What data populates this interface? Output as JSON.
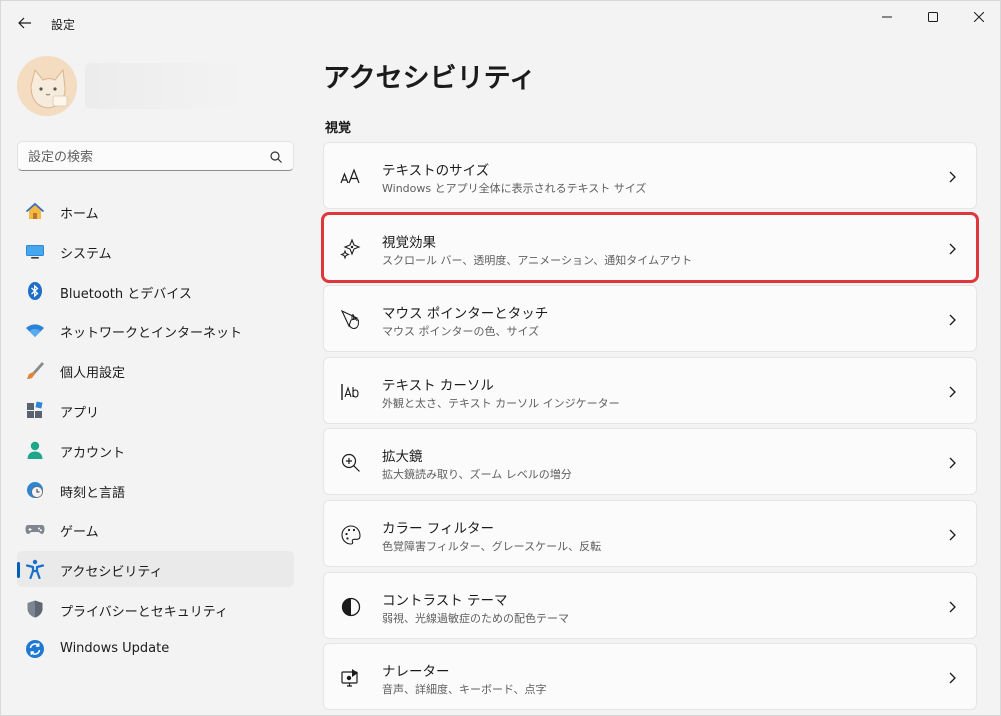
{
  "window": {
    "title": "設定"
  },
  "search": {
    "placeholder": "設定の検索"
  },
  "sidebar": {
    "items": [
      {
        "label": "ホーム",
        "icon": "home-icon"
      },
      {
        "label": "システム",
        "icon": "system-icon"
      },
      {
        "label": "Bluetooth とデバイス",
        "icon": "bluetooth-icon"
      },
      {
        "label": "ネットワークとインターネット",
        "icon": "wifi-icon"
      },
      {
        "label": "個人用設定",
        "icon": "brush-icon"
      },
      {
        "label": "アプリ",
        "icon": "apps-icon"
      },
      {
        "label": "アカウント",
        "icon": "account-icon"
      },
      {
        "label": "時刻と言語",
        "icon": "clock-globe-icon"
      },
      {
        "label": "ゲーム",
        "icon": "gamepad-icon"
      },
      {
        "label": "アクセシビリティ",
        "icon": "accessibility-icon"
      },
      {
        "label": "プライバシーとセキュリティ",
        "icon": "shield-icon"
      },
      {
        "label": "Windows Update",
        "icon": "update-icon"
      }
    ],
    "selected": "アクセシビリティ"
  },
  "main": {
    "title": "アクセシビリティ",
    "section": "視覚",
    "cards": [
      {
        "title": "テキストのサイズ",
        "desc": "Windows とアプリ全体に表示されるテキスト サイズ",
        "icon": "text-size-icon"
      },
      {
        "title": "視覚効果",
        "desc": "スクロール バー、透明度、アニメーション、通知タイムアウト",
        "icon": "visual-effects-icon"
      },
      {
        "title": "マウス ポインターとタッチ",
        "desc": "マウス ポインターの色、サイズ",
        "icon": "pointer-touch-icon"
      },
      {
        "title": "テキスト カーソル",
        "desc": "外観と太さ、テキスト カーソル インジケーター",
        "icon": "text-cursor-icon"
      },
      {
        "title": "拡大鏡",
        "desc": "拡大鏡読み取り、ズーム レベルの増分",
        "icon": "magnifier-icon"
      },
      {
        "title": "カラー フィルター",
        "desc": "色覚障害フィルター、グレースケール、反転",
        "icon": "color-filter-icon"
      },
      {
        "title": "コントラスト テーマ",
        "desc": "弱視、光線過敏症のための配色テーマ",
        "icon": "contrast-icon"
      },
      {
        "title": "ナレーター",
        "desc": "音声、詳細度、キーボード、点字",
        "icon": "narrator-icon"
      }
    ],
    "highlighted_card": "視覚効果"
  },
  "colors": {
    "accent": "#005fb8",
    "highlight": "#e0373c",
    "background": "#f3f3f3",
    "card": "#fbfbfb"
  }
}
